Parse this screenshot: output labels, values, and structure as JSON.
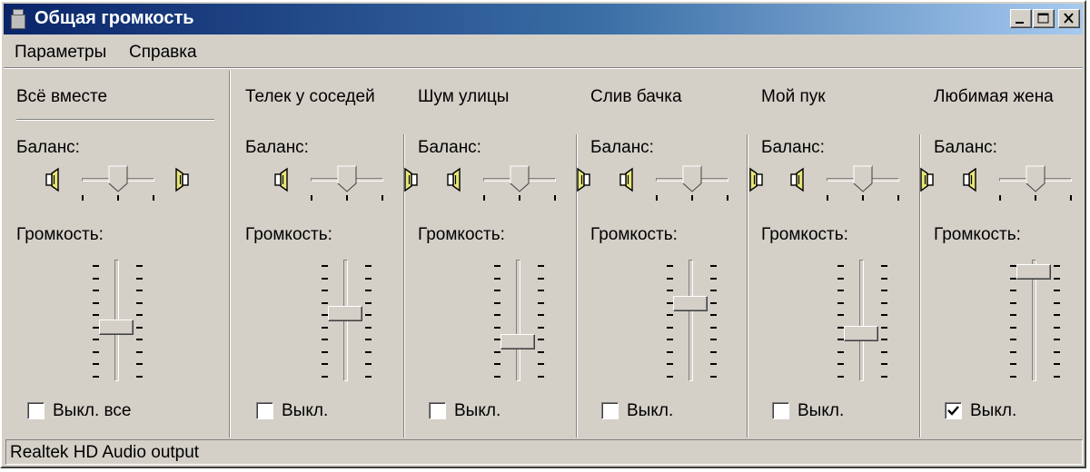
{
  "window": {
    "title": "Общая громкость",
    "buttons": [
      "minimize",
      "maximize",
      "close"
    ]
  },
  "menu": [
    "Параметры",
    "Справка"
  ],
  "labels": {
    "balance": "Баланс:",
    "volume": "Громкость:"
  },
  "icons": {
    "balance_left": "speaker-left-icon",
    "balance_right": "speaker-right-icon",
    "window": "volume-app-icon"
  },
  "channels": [
    {
      "name": "Всё вместе",
      "balance": 0.5,
      "volume": 0.44,
      "muted": false,
      "mute_label": "Выкл. все"
    },
    {
      "name": "Телек у соседей",
      "balance": 0.5,
      "volume": 0.56,
      "muted": false,
      "mute_label": "Выкл."
    },
    {
      "name": "Шум улицы",
      "balance": 0.5,
      "volume": 0.3,
      "muted": false,
      "mute_label": "Выкл."
    },
    {
      "name": "Слив бачка",
      "balance": 0.5,
      "volume": 0.66,
      "muted": false,
      "mute_label": "Выкл."
    },
    {
      "name": "Мой пук",
      "balance": 0.5,
      "volume": 0.38,
      "muted": false,
      "mute_label": "Выкл."
    },
    {
      "name": "Любимая жена",
      "balance": 0.5,
      "volume": 0.96,
      "muted": true,
      "mute_label": "Выкл."
    }
  ],
  "status": "Realtek HD Audio output"
}
